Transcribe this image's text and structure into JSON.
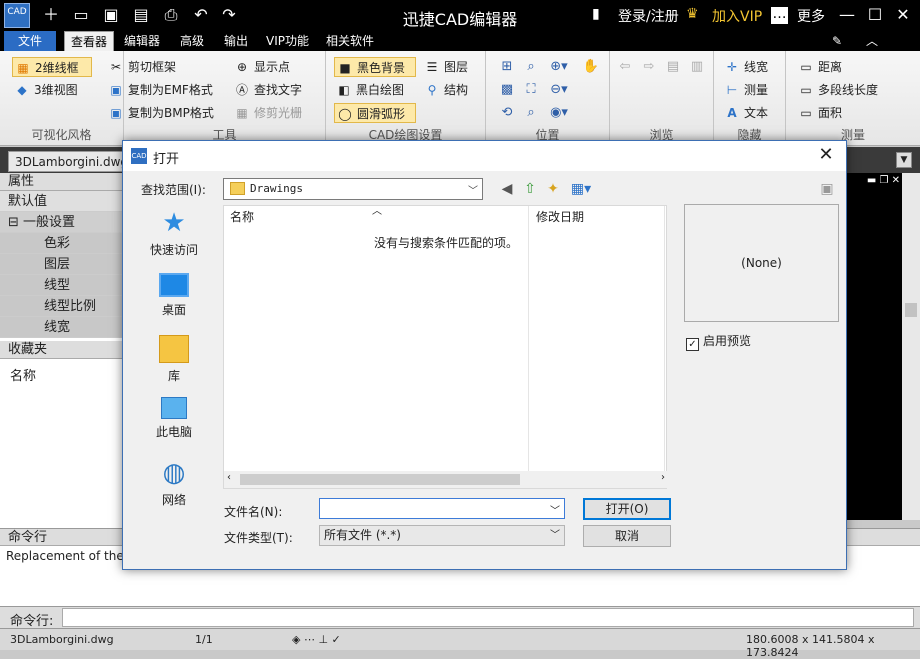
{
  "window": {
    "logo_text": "CAD",
    "title": "迅捷CAD编辑器",
    "login": "登录/注册",
    "vip": "加入VIP",
    "more": "更多"
  },
  "menu": {
    "tabs": [
      "文件",
      "查看器",
      "编辑器",
      "高级",
      "输出",
      "VIP功能",
      "相关软件"
    ]
  },
  "ribbon": {
    "visual_style": {
      "label": "可视化风格",
      "items": [
        "2维线框",
        "3维视图"
      ]
    },
    "tools": {
      "label": "工具",
      "items": [
        "剪切框架",
        "复制为EMF格式",
        "复制为BMP格式",
        "显示点",
        "查找文字",
        "修剪光栅"
      ]
    },
    "cad_settings": {
      "label": "CAD绘图设置",
      "items": [
        "黑色背景",
        "黑白绘图",
        "圆滑弧形",
        "图层",
        "结构"
      ]
    },
    "position": {
      "label": "位置"
    },
    "browse": {
      "label": "浏览"
    },
    "hide": {
      "label": "隐藏",
      "items": [
        "线宽",
        "测量",
        "文本"
      ]
    },
    "measure": {
      "label": "测量",
      "items": [
        "距离",
        "多段线长度",
        "面积"
      ]
    }
  },
  "document": {
    "tab": "3DLamborgini.dwg"
  },
  "properties": {
    "header": "属性",
    "default": "默认值",
    "group": "一般设置",
    "rows": [
      "色彩",
      "图层",
      "线型",
      "线型比例",
      "线宽"
    ]
  },
  "favorites": {
    "header": "收藏夹",
    "col": "名称"
  },
  "command": {
    "header": "命令行",
    "log": "Replacement of the [G",
    "input_label": "命令行:"
  },
  "status": {
    "file": "3DLamborgini.dwg",
    "page": "1/1",
    "coords": "180.6008 x 141.5804 x 173.8424"
  },
  "dialog": {
    "title": "打开",
    "icon_text": "CAD",
    "look_in_label": "查找范围(I):",
    "look_in_value": "Drawings",
    "places": [
      "快速访问",
      "桌面",
      "库",
      "此电脑",
      "网络"
    ],
    "col_name": "名称",
    "col_date": "修改日期",
    "empty_msg": "没有与搜索条件匹配的项。",
    "preview": "(None)",
    "enable_preview": "启用预览",
    "filename_label": "文件名(N):",
    "filename_value": "",
    "filetype_label": "文件类型(T):",
    "filetype_value": "所有文件 (*.*)",
    "open_btn": "打开(O)",
    "cancel_btn": "取消"
  }
}
